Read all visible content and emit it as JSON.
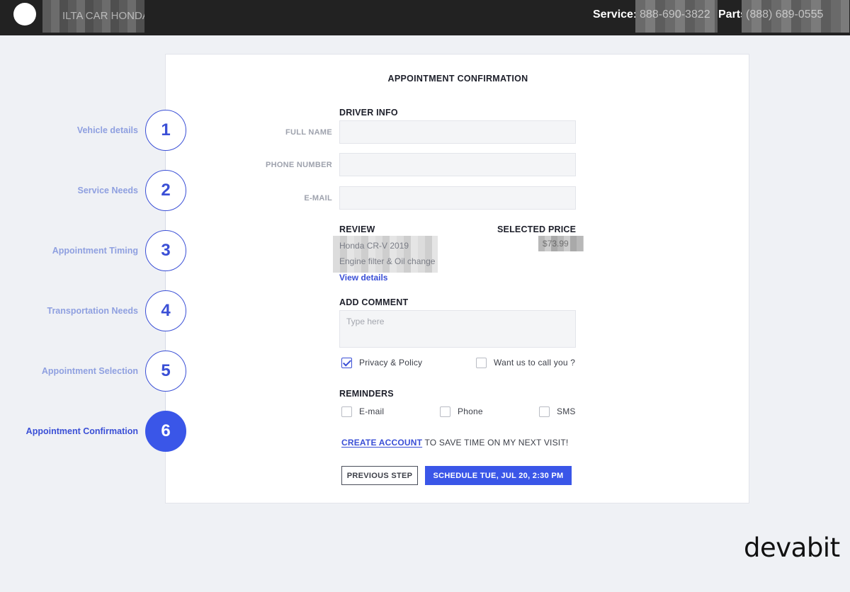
{
  "topbar": {
    "dealer_name": "ILTA CAR HONDA",
    "service_label": "Service:",
    "service_phone": "888-690-3822",
    "parts_label": "Parts:",
    "parts_phone": "(888) 689-0555"
  },
  "page": {
    "title": "APPOINTMENT CONFIRMATION"
  },
  "steps": [
    {
      "number": "1",
      "label": "Vehicle details"
    },
    {
      "number": "2",
      "label": "Service Needs"
    },
    {
      "number": "3",
      "label": "Appointment Timing"
    },
    {
      "number": "4",
      "label": "Transportation Needs"
    },
    {
      "number": "5",
      "label": "Appointment Selection"
    },
    {
      "number": "6",
      "label": "Appointment Confirmation"
    }
  ],
  "active_step": "6",
  "driver_info": {
    "heading": "DRIVER INFO",
    "full_name_label": "FULL NAME",
    "full_name_value": "",
    "phone_label": "PHONE NUMBER",
    "phone_value": "",
    "email_label": "E-MAIL",
    "email_value": ""
  },
  "review": {
    "heading": "REVIEW",
    "vehicle": "Honda CR-V 2019",
    "service": "Engine filter & Oil change",
    "view_details": "View details",
    "price_heading": "SELECTED PRICE",
    "price_value": "$73.99"
  },
  "comment": {
    "heading": "ADD COMMENT",
    "placeholder": "Type here"
  },
  "consent": {
    "privacy_label": "Privacy & Policy",
    "privacy_checked": true,
    "call_label": "Want us to call you ?",
    "call_checked": false
  },
  "reminders": {
    "heading": "REMINDERS",
    "email_label": "E-mail",
    "phone_label": "Phone",
    "sms_label": "SMS"
  },
  "account": {
    "link_text": "CREATE ACCOUNT",
    "rest_text": " TO SAVE TIME ON MY NEXT VISIT!"
  },
  "actions": {
    "previous_label": "PREVIOUS STEP",
    "schedule_label": "SCHEDULE TUE, JUL 20, 2:30 PM"
  },
  "watermark": "devabit",
  "colors": {
    "accent": "#3a56e8",
    "step_label": "#8fa0e0",
    "topbar": "#222222",
    "background": "#eff1f5"
  }
}
